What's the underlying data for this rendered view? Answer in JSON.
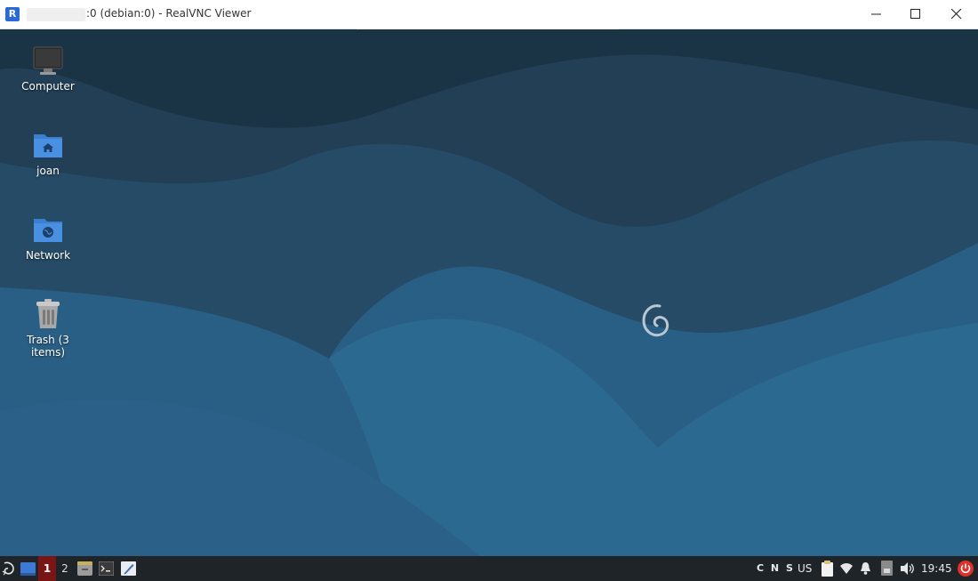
{
  "window": {
    "title": ":0 (debian:0) - RealVNC Viewer",
    "app_icon_glyph": "R"
  },
  "desktop": {
    "icons": [
      {
        "label": "Computer",
        "icon": "computer-icon"
      },
      {
        "label": "joan",
        "icon": "home-folder-icon"
      },
      {
        "label": "Network",
        "icon": "network-folder-icon"
      },
      {
        "label": "Trash (3 items)",
        "icon": "trash-icon"
      }
    ]
  },
  "taskbar": {
    "workspaces": [
      "1",
      "2"
    ],
    "active_workspace": "1",
    "keyboard_indicators": "C N S",
    "keyboard_layout": "US",
    "clock": "19:45"
  },
  "colors": {
    "desktop_dark": "#1e3a4f",
    "desktop_mid": "#244e6c",
    "desktop_light": "#2a6791",
    "taskbar_bg": "#1e2428",
    "active_workspace": "#7a1515",
    "power_red": "#e0302a"
  }
}
